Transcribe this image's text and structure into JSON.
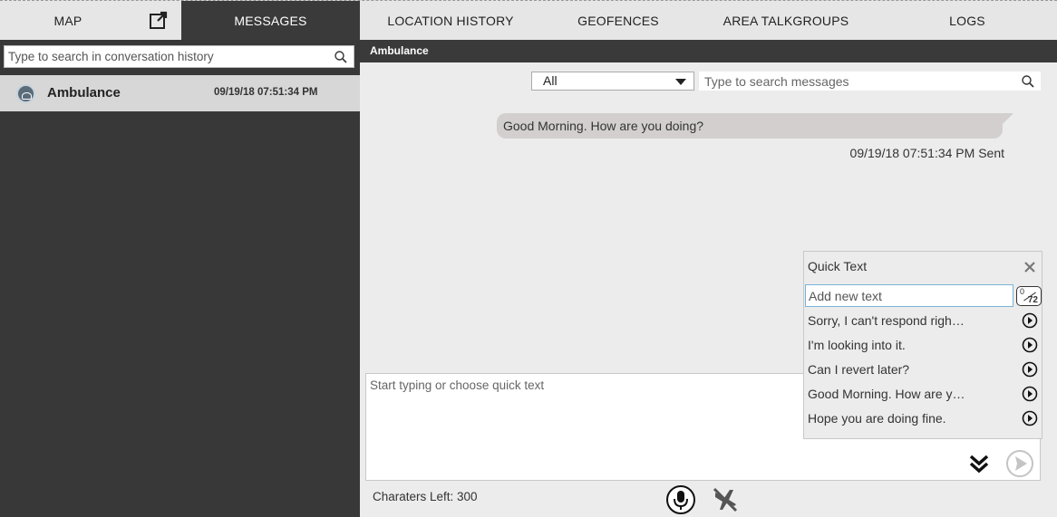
{
  "tabs": {
    "map": "MAP",
    "messages": "MESSAGES",
    "location_history": "LOCATION HISTORY",
    "geofences": "GEOFENCES",
    "area_talkgroups": "AREA TALKGROUPS",
    "logs": "LOGS"
  },
  "left": {
    "search_placeholder": "Type to search in conversation history",
    "conversations": [
      {
        "name": "Ambulance",
        "time": "09/19/18 07:51:34 PM",
        "icon": "ambulance-avatar-icon"
      }
    ]
  },
  "conversation": {
    "title": "Ambulance",
    "filter_value": "All",
    "search_placeholder": "Type to search messages",
    "messages": [
      {
        "text": "Good Morning. How are you doing?",
        "meta": "09/19/18 07:51:34 PM Sent"
      }
    ]
  },
  "compose": {
    "placeholder": "Start typing or choose quick text",
    "chars_left": "Charaters Left: 300"
  },
  "quick_text": {
    "title": "Quick Text",
    "input_placeholder": "Add new text",
    "counter_current": "0",
    "counter_max": "72",
    "items": [
      "Sorry, I can't respond righ…",
      "I'm looking into it.",
      "Can I revert later?",
      "Good Morning. How are y…",
      "Hope you are doing fine."
    ]
  },
  "colors": {
    "dark_panel": "#383838",
    "selected_row": "#d7d7d7",
    "bubble": "#d3cfcf",
    "background": "#ececec"
  }
}
